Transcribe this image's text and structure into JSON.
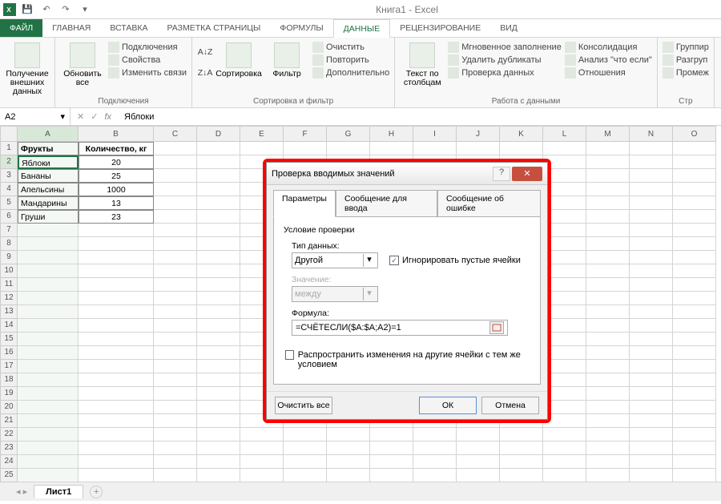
{
  "app": {
    "title": "Книга1 - Excel"
  },
  "qat": {
    "save": "💾",
    "undo": "↶",
    "redo": "↷"
  },
  "tabs": {
    "file": "ФАЙЛ",
    "home": "ГЛАВНАЯ",
    "insert": "ВСТАВКА",
    "layout": "РАЗМЕТКА СТРАНИЦЫ",
    "formulas": "ФОРМУЛЫ",
    "data": "ДАННЫЕ",
    "review": "РЕЦЕНЗИРОВАНИЕ",
    "view": "ВИД"
  },
  "ribbon": {
    "g1": {
      "btn": "Получение внешних данных",
      "label": ""
    },
    "g2": {
      "refresh": "Обновить все",
      "conn": "Подключения",
      "props": "Свойства",
      "links": "Изменить связи",
      "label": "Подключения"
    },
    "g3": {
      "sort": "Сортировка",
      "filter": "Фильтр",
      "clear": "Очистить",
      "reapply": "Повторить",
      "adv": "Дополнительно",
      "label": "Сортировка и фильтр"
    },
    "g4": {
      "ttc": "Текст по столбцам",
      "flash": "Мгновенное заполнение",
      "dup": "Удалить дубликаты",
      "dv": "Проверка данных",
      "cons": "Консолидация",
      "whatif": "Анализ \"что если\"",
      "rel": "Отношения",
      "label": "Работа с данными"
    },
    "g5": {
      "group": "Группир",
      "ungroup": "Разгруп",
      "subtotal": "Промеж",
      "label": "Стр"
    }
  },
  "namebox": "A2",
  "formula": "Яблоки",
  "cols": [
    "A",
    "B",
    "C",
    "D",
    "E",
    "F",
    "G",
    "H",
    "I",
    "J",
    "K",
    "L",
    "M",
    "N",
    "O"
  ],
  "sheet_data": {
    "headers": {
      "a": "Фрукты",
      "b": "Количество, кг"
    },
    "r2": {
      "a": "Яблоки",
      "b": "20"
    },
    "r3": {
      "a": "Бананы",
      "b": "25"
    },
    "r4": {
      "a": "Апельсины",
      "b": "1000"
    },
    "r5": {
      "a": "Мандарины",
      "b": "13"
    },
    "r6": {
      "a": "Груши",
      "b": "23"
    }
  },
  "sheet": {
    "name": "Лист1"
  },
  "dialog": {
    "title": "Проверка вводимых значений",
    "tabs": {
      "t1": "Параметры",
      "t2": "Сообщение для ввода",
      "t3": "Сообщение об ошибке"
    },
    "section": "Условие проверки",
    "type_label": "Тип данных:",
    "type_value": "Другой",
    "ignore": "Игнорировать пустые ячейки",
    "val_label": "Значение:",
    "val_value": "между",
    "formula_label": "Формула:",
    "formula_value": "=СЧЁТЕСЛИ($A:$A;A2)=1",
    "propagate": "Распространить изменения на другие ячейки с тем же условием",
    "clear": "Очистить все",
    "ok": "ОК",
    "cancel": "Отмена"
  }
}
